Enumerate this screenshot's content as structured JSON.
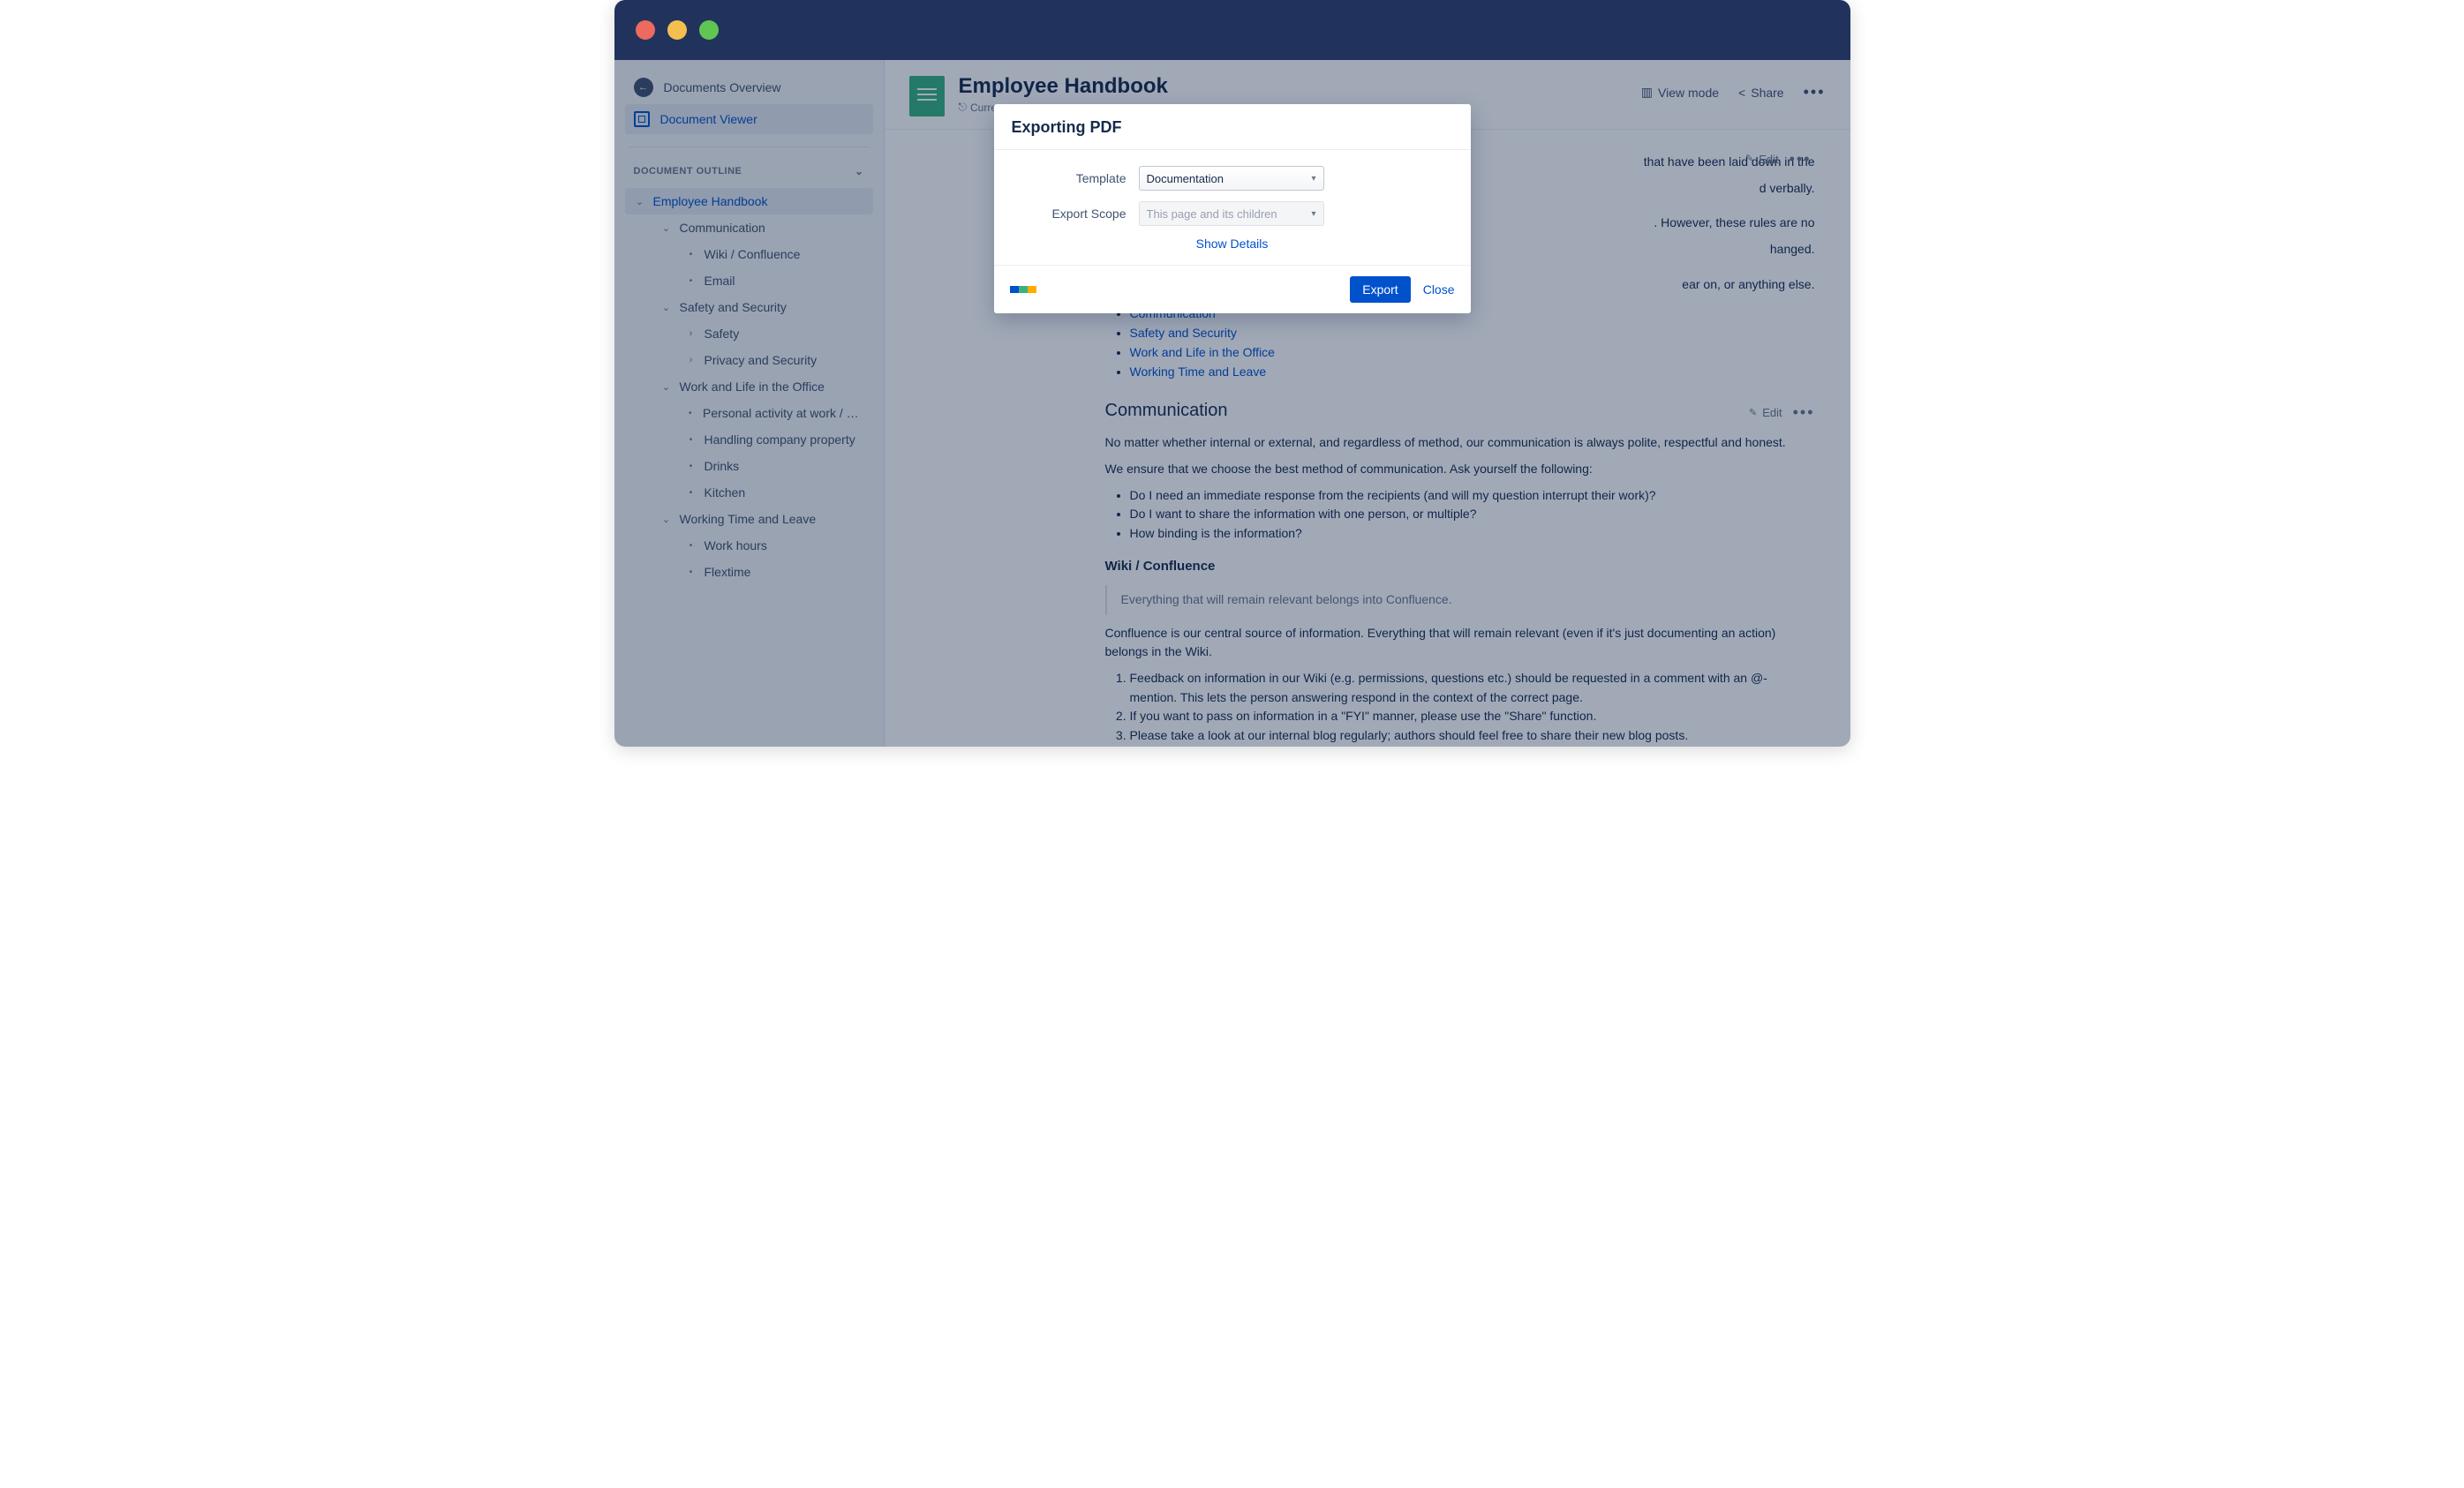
{
  "sidebar": {
    "overview_label": "Documents Overview",
    "viewer_label": "Document Viewer",
    "outline_header": "DOCUMENT OUTLINE"
  },
  "tree": {
    "root": "Employee Handbook",
    "items": [
      {
        "label": "Communication",
        "children": [
          {
            "label": "Wiki / Confluence"
          },
          {
            "label": "Email"
          }
        ]
      },
      {
        "label": "Safety and Security",
        "children": [
          {
            "label": "Safety",
            "expandable": true
          },
          {
            "label": "Privacy and Security",
            "expandable": true
          }
        ]
      },
      {
        "label": "Work and Life in the Office",
        "children": [
          {
            "label": "Personal activity at work / pers…"
          },
          {
            "label": "Handling company property"
          },
          {
            "label": "Drinks"
          },
          {
            "label": "Kitchen"
          }
        ]
      },
      {
        "label": "Working Time and Leave",
        "children": [
          {
            "label": "Work hours"
          },
          {
            "label": "Flextime"
          }
        ]
      }
    ]
  },
  "page": {
    "title": "Employee Handbook",
    "meta_prefix": "Curren",
    "view_mode": "View mode",
    "share": "Share",
    "edit": "Edit"
  },
  "content": {
    "p1": "that have been laid down in the",
    "p1b": "d verbally.",
    "p2": ". However, these rules are no",
    "p2b": "hanged.",
    "p3": "ear on, or anything else.",
    "toc": [
      "Communication",
      "Safety and Security",
      "Work and Life in the Office",
      "Working Time and Leave"
    ],
    "h_comm": "Communication",
    "comm_p1": "No matter whether internal or external, and regardless of method, our communication is always polite, respectful and honest.",
    "comm_p2": "We ensure that we choose the best method of communication. Ask yourself the following:",
    "comm_q": [
      "Do I need an immediate response from the recipients (and will my question interrupt their work)?",
      "Do I want to share the information with one person, or multiple?",
      "How binding is the information?"
    ],
    "h_wiki": "Wiki / Confluence",
    "quote": "Everything that will remain relevant belongs into Confluence.",
    "wiki_p1": "Confluence is our central source of information. Everything that will remain relevant (even if it's just documenting an action) belongs in the Wiki.",
    "wiki_list": [
      "Feedback on information in our Wiki (e.g. permissions, questions etc.) should be requested in a comment with an @-mention. This lets the person answering respond in the context of the correct page.",
      "If you want to pass on information in a \"FYI\" manner, please use the \"Share\" function.",
      "Please take a look at our internal blog regularly; authors should feel free to share their new blog posts."
    ]
  },
  "modal": {
    "title": "Exporting PDF",
    "template_label": "Template",
    "template_value": "Documentation",
    "scope_label": "Export Scope",
    "scope_value": "This page and its children",
    "show_details": "Show Details",
    "export": "Export",
    "close": "Close"
  }
}
